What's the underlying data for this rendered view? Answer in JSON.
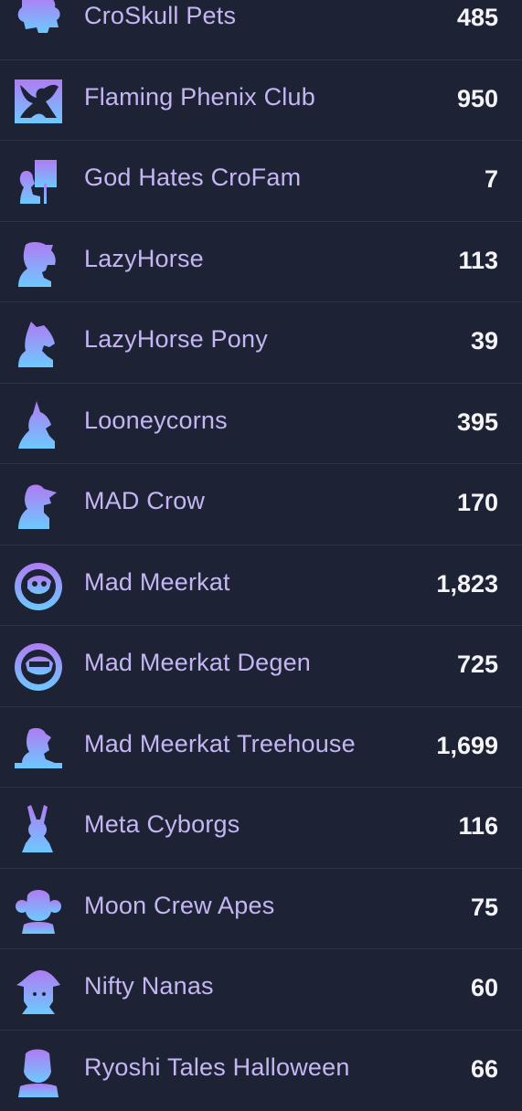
{
  "collections": [
    {
      "name": "CroSkull Pets",
      "count": "485",
      "icon": "croskull-pets-icon"
    },
    {
      "name": "Flaming Phenix Club",
      "count": "950",
      "icon": "phenix-icon"
    },
    {
      "name": "God Hates CroFam",
      "count": "7",
      "icon": "sign-icon"
    },
    {
      "name": "LazyHorse",
      "count": "113",
      "icon": "horse-icon"
    },
    {
      "name": "LazyHorse Pony",
      "count": "39",
      "icon": "pony-icon"
    },
    {
      "name": "Looneycorns",
      "count": "395",
      "icon": "unicorn-icon"
    },
    {
      "name": "MAD Crow",
      "count": "170",
      "icon": "crow-icon"
    },
    {
      "name": "Mad Meerkat",
      "count": "1,823",
      "icon": "meerkat-badge-icon"
    },
    {
      "name": "Mad Meerkat Degen",
      "count": "725",
      "icon": "meerkat-degen-icon"
    },
    {
      "name": "Mad Meerkat Treehouse",
      "count": "1,699",
      "icon": "meerkat-treehouse-icon"
    },
    {
      "name": "Meta Cyborgs",
      "count": "116",
      "icon": "rabbit-icon"
    },
    {
      "name": "Moon Crew Apes",
      "count": "75",
      "icon": "ape-icon"
    },
    {
      "name": "Nifty Nanas",
      "count": "60",
      "icon": "banana-hat-icon"
    },
    {
      "name": "Ryoshi Tales Halloween",
      "count": "66",
      "icon": "halloween-icon"
    }
  ],
  "colors": {
    "background": "#1e2235",
    "name_text": "#c4b6f3",
    "count_text": "#f4f4f7",
    "icon_gradient_top": "#b07cf2",
    "icon_gradient_bottom": "#6cc9ff"
  }
}
